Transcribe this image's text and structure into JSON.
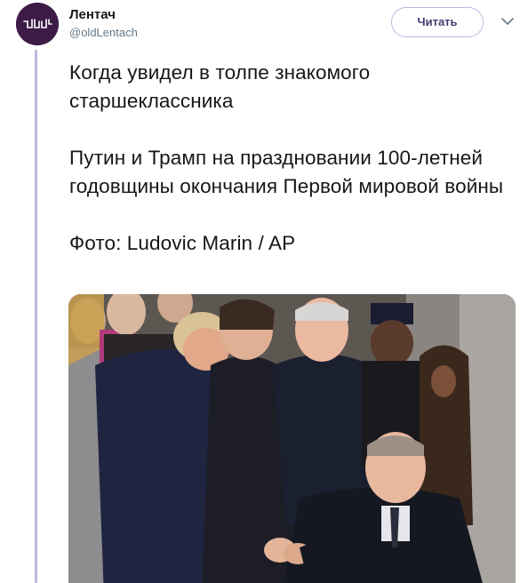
{
  "account": {
    "name": "Лентач",
    "handle": "@oldLentach",
    "avatar_icon": "lentach-logo-icon",
    "avatar_color": "#3c1c47"
  },
  "header": {
    "follow_label": "Читать",
    "menu_icon": "chevron-down-icon"
  },
  "tweet": {
    "paragraphs": [
      "Когда увидел в толпе знакомого старшеклассника",
      "Путин и Трамп на праздновании 100-летней годовщины окончания Первой мировой войны",
      "Фото: Ludovic Marin / AP"
    ]
  },
  "media": {
    "type": "photo",
    "icon": "news-photo-image"
  },
  "colors": {
    "accent": "#c3b4dd",
    "button_text": "#4a3a70",
    "text": "#14171a",
    "secondary": "#657786"
  }
}
